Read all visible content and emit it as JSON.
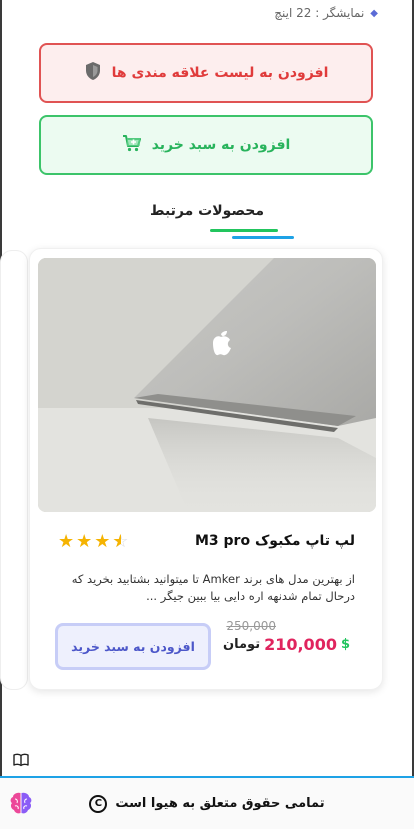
{
  "spec": {
    "label": "نمایشگر : 22 اینچ"
  },
  "actions": {
    "wishlist_label": "افزودن به لیست علاقه مندی ها",
    "add_to_cart_label": "افزودن به سبد خرید"
  },
  "related": {
    "title": "محصولات مرتبط"
  },
  "product": {
    "title": "لپ تاپ مکبوک M3 pro",
    "rating": 3.5,
    "rating_max": 5,
    "description": "از بهترین مدل های برند Amker تا میتوانید بشتابید بخرید که درحال تمام شدنهه اره دایی بیا ببین جیگر ...",
    "old_price": "250,000",
    "price": "210,000",
    "currency": "تومان",
    "currency_icon": "$",
    "cart_button_label": "افزودن به سبد خرید"
  },
  "footer": {
    "text": "تمامی حقوق متعلق به هیوا است"
  },
  "colors": {
    "wishlist_border": "#e05353",
    "cart_border": "#3cc46a",
    "price_color": "#e0245e",
    "accent_blue": "#1ea2e6"
  }
}
